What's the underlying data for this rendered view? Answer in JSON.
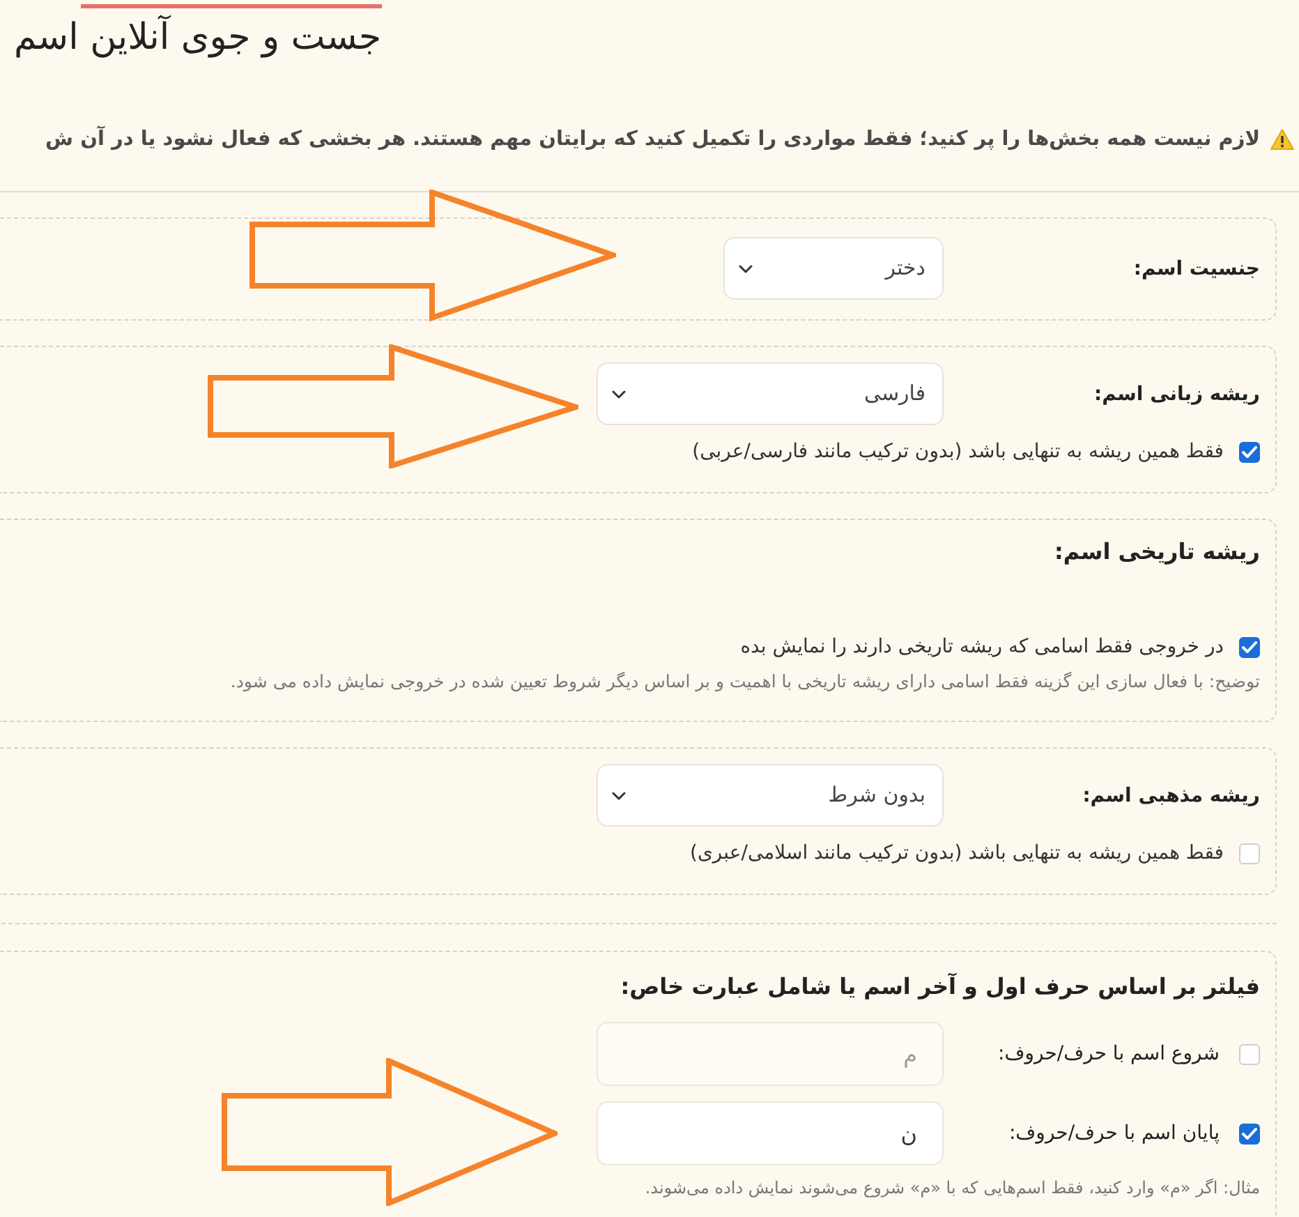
{
  "page": {
    "title": "جست و جوی آنلاین اسم"
  },
  "notice": {
    "text": "لازم نیست همه بخش‌ها را پر کنید؛ فقط مواردی را تکمیل کنید که برایتان مهم هستند. هر بخشی که فعال نشود یا در آن ش"
  },
  "sections": [
    {
      "kind": "select",
      "label": "جنسیت اسم:",
      "select": {
        "value": "دختر",
        "pointer_arrow": true
      }
    },
    {
      "kind": "select",
      "label": "ریشه زبانی اسم:",
      "select": {
        "value": "فارسی",
        "pointer_arrow": true
      },
      "option": {
        "label": "فقط همین ریشه به تنهایی باشد (بدون ترکیب مانند فارسی/عربی)",
        "checked": true
      }
    },
    {
      "kind": "checkbox",
      "heading": "ریشه تاریخی اسم:",
      "option": {
        "label": "در خروجی فقط اسامی که ریشه تاریخی دارند را نمایش بده",
        "checked": true
      },
      "note": "توضیح: با فعال سازی این گزینه فقط اسامی دارای ریشه تاریخی با اهمیت و بر اساس دیگر شروط تعیین شده در خروجی نمایش داده می شود."
    },
    {
      "kind": "select",
      "label": "ریشه مذهبی اسم:",
      "select": {
        "value": "بدون شرط"
      },
      "option": {
        "label": "فقط همین ریشه به تنهایی باشد (بدون ترکیب مانند اسلامی/عبری)",
        "checked": false
      }
    },
    {
      "kind": "filter",
      "heading": "فیلتر بر اساس حرف اول و آخر اسم یا شامل عبارت خاص:",
      "rows": [
        {
          "label": "شروع اسم با حرف/حروف:",
          "checked": false,
          "placeholder": "م"
        },
        {
          "label": "پایان اسم با حرف/حروف:",
          "checked": true,
          "value": "ن",
          "pointer_arrow": true
        }
      ],
      "note": "مثال: اگر «م» وارد کنید، فقط اسم‌هایی که با «م» شروع می‌شوند نمایش داده می‌شوند."
    }
  ]
}
